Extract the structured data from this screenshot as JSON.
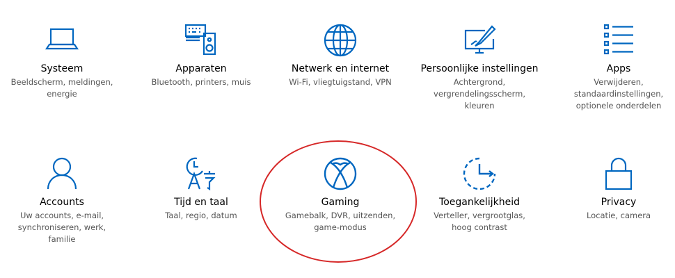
{
  "accent_color": "#0067c0",
  "annotation_color": "#d62828",
  "tiles": [
    {
      "icon": "laptop-icon",
      "title": "Systeem",
      "desc": [
        "Beeldscherm, meldingen,",
        "energie"
      ]
    },
    {
      "icon": "devices-icon",
      "title": "Apparaten",
      "desc": [
        "Bluetooth, printers, muis"
      ]
    },
    {
      "icon": "globe-icon",
      "title": "Netwerk en internet",
      "desc": [
        "Wi-Fi, vliegtuigstand, VPN"
      ]
    },
    {
      "icon": "personalization-icon",
      "title": "Persoonlijke instellingen",
      "desc": [
        "Achtergrond,",
        "vergrendelingsscherm,",
        "kleuren"
      ]
    },
    {
      "icon": "apps-list-icon",
      "title": "Apps",
      "desc": [
        "Verwijderen,",
        "standaardinstellingen,",
        "optionele onderdelen"
      ]
    },
    {
      "icon": "person-icon",
      "title": "Accounts",
      "desc": [
        "Uw accounts, e-mail,",
        "synchroniseren, werk,",
        "familie"
      ]
    },
    {
      "icon": "time-language-icon",
      "title": "Tijd en taal",
      "desc": [
        "Taal, regio, datum"
      ]
    },
    {
      "icon": "xbox-icon",
      "title": "Gaming",
      "desc": [
        "Gamebalk, DVR, uitzenden,",
        "game-modus"
      ]
    },
    {
      "icon": "ease-of-access-icon",
      "title": "Toegankelijkheid",
      "desc": [
        "Verteller, vergrootglas,",
        "hoog contrast"
      ]
    },
    {
      "icon": "lock-icon",
      "title": "Privacy",
      "desc": [
        "Locatie, camera"
      ]
    }
  ]
}
